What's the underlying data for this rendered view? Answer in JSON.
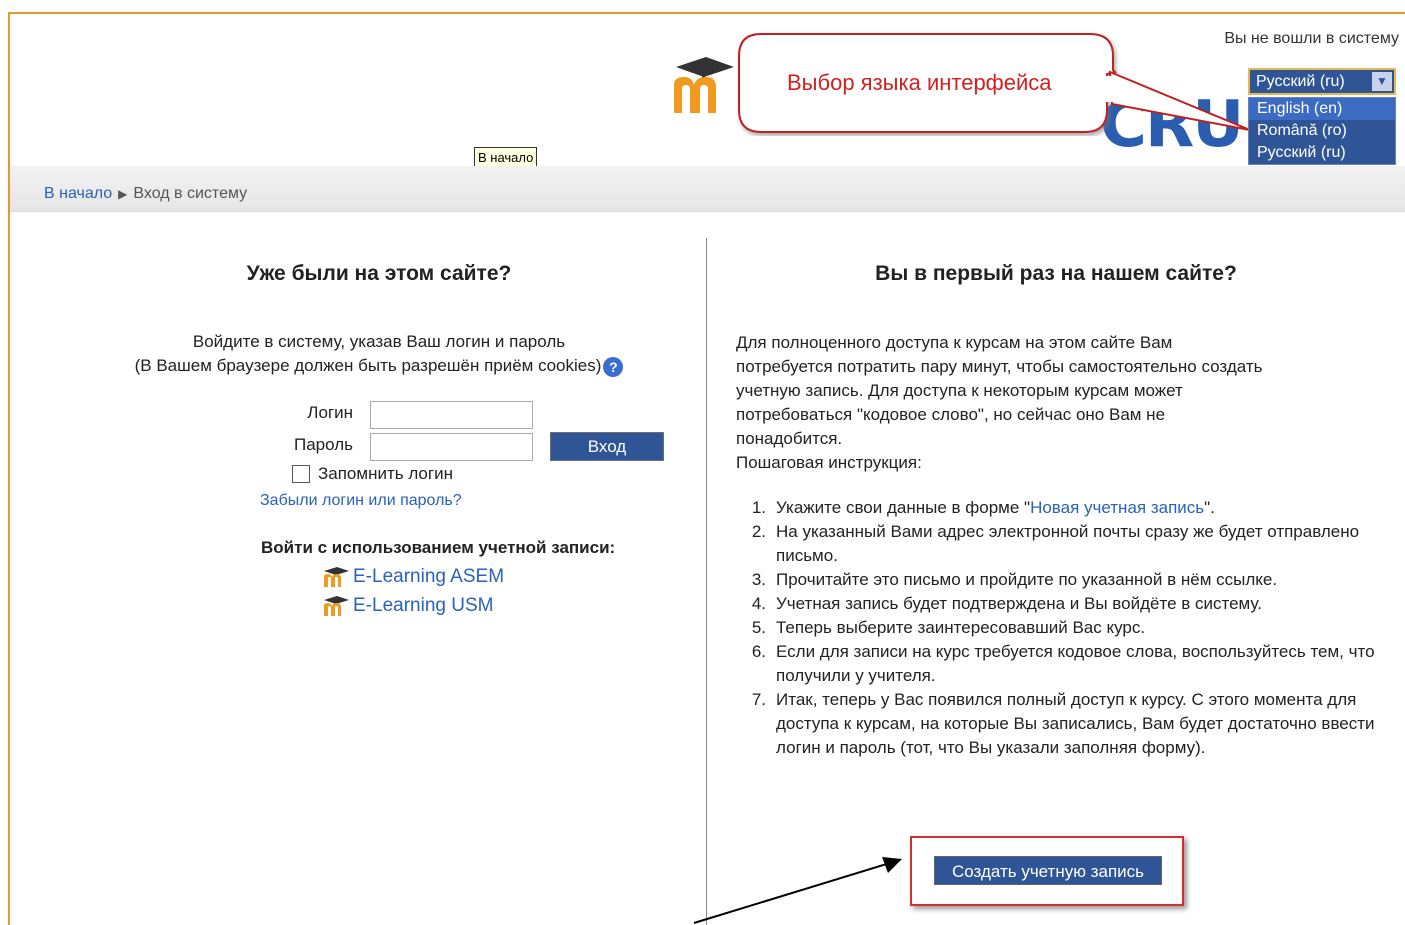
{
  "header": {
    "login_status": "Вы не вошли в систему",
    "callout_text": "Выбор языка интерфейса",
    "tooltip_text": "В начало"
  },
  "language": {
    "selected": "Русский (ru)",
    "options": [
      "English (en)",
      "Română (ro)",
      "Русский (ru)"
    ]
  },
  "breadcrumb": {
    "home": "В начало",
    "current": "Вход в систему"
  },
  "login": {
    "title": "Уже были на этом сайте?",
    "info_line1": "Войдите в систему, указав Ваш логин и пароль",
    "info_line2": "(В Вашем браузере должен быть разрешён приём cookies)",
    "username_label": "Логин",
    "password_label": "Пароль",
    "submit_label": "Вход",
    "remember_label": "Запомнить логин",
    "forgot_link": "Забыли логин или пароль?",
    "auth_title": "Войти с использованием учетной записи:",
    "auth_providers": [
      "E-Learning ASEM",
      "E-Learning USM"
    ]
  },
  "signup": {
    "title": "Вы в первый раз на нашем сайте?",
    "intro_lines": [
      "Для полноценного доступа к курсам на этом сайте Вам",
      "потребуется потратить пару минут, чтобы самостоятельно создать",
      "учетную запись. Для доступа к некоторым курсам может",
      "потребоваться \"кодовое слово\", но сейчас оно Вам не",
      "понадобится.",
      "Пошаговая инструкция:"
    ],
    "step1_pre": "Укажите свои данные в форме \"",
    "step1_link": "Новая учетная запись",
    "step1_post": "\".",
    "steps": [
      "На указанный Вами адрес электронной почты сразу же будет отправлено письмо.",
      "Прочитайте это письмо и пройдите по указанной в нём ссылке.",
      "Учетная запись будет подтверждена и Вы войдёте в систему.",
      "Теперь выберите заинтересовавший Вас курс.",
      "Если для записи на курс требуется кодовое слова, воспользуйтесь тем, что получили у учителя.",
      "Итак, теперь у Вас появился полный доступ к курсу. С этого момента для доступа к курсам, на которые Вы записались, Вам будет достаточно ввести логин и пароль (тот, что Вы указали заполняя форму)."
    ],
    "create_button": "Создать учетную запись"
  },
  "colors": {
    "accent_blue": "#2f5597",
    "link_blue": "#2a62b8",
    "callout_red": "#d42020",
    "frame_orange": "#e69a2e"
  }
}
